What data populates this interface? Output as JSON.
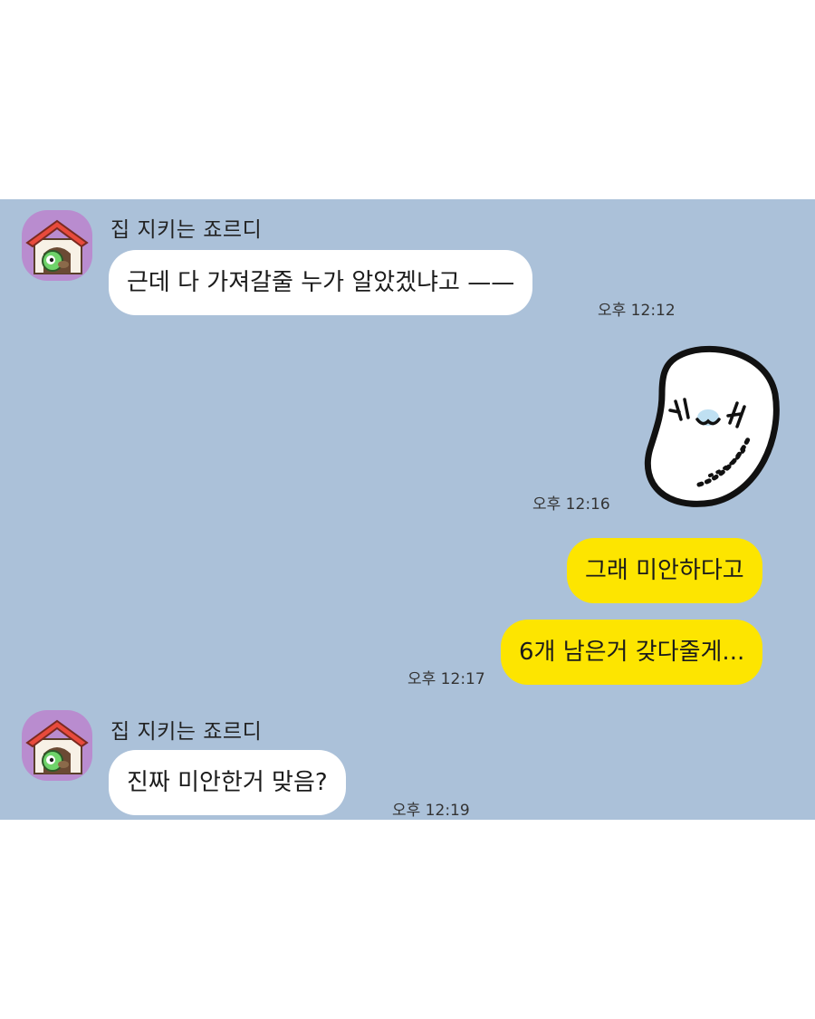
{
  "messages": [
    {
      "direction": "in",
      "sender": "집 지키는 죠르디",
      "text": "근데 다 가져갈줄 누가 알았겠냐고 ——",
      "time": "오후 12:12",
      "avatar_icon": "doghouse-avatar-icon"
    },
    {
      "direction": "out",
      "type": "sticker",
      "sticker_icon": "white-blob-sticker-icon",
      "time": "오후 12:16"
    },
    {
      "direction": "out",
      "text": "그래 미안하다고"
    },
    {
      "direction": "out",
      "text": "6개 남은거 갖다줄게...",
      "time": "오후 12:17"
    },
    {
      "direction": "in",
      "sender": "집 지키는 죠르디",
      "text": "진짜 미안한거 맞음?",
      "time": "오후 12:19",
      "avatar_icon": "doghouse-avatar-icon"
    }
  ],
  "colors": {
    "chat_background": "#abc1d9",
    "incoming_bubble": "#ffffff",
    "outgoing_bubble": "#fde500",
    "avatar_background": "#b98ccf"
  }
}
